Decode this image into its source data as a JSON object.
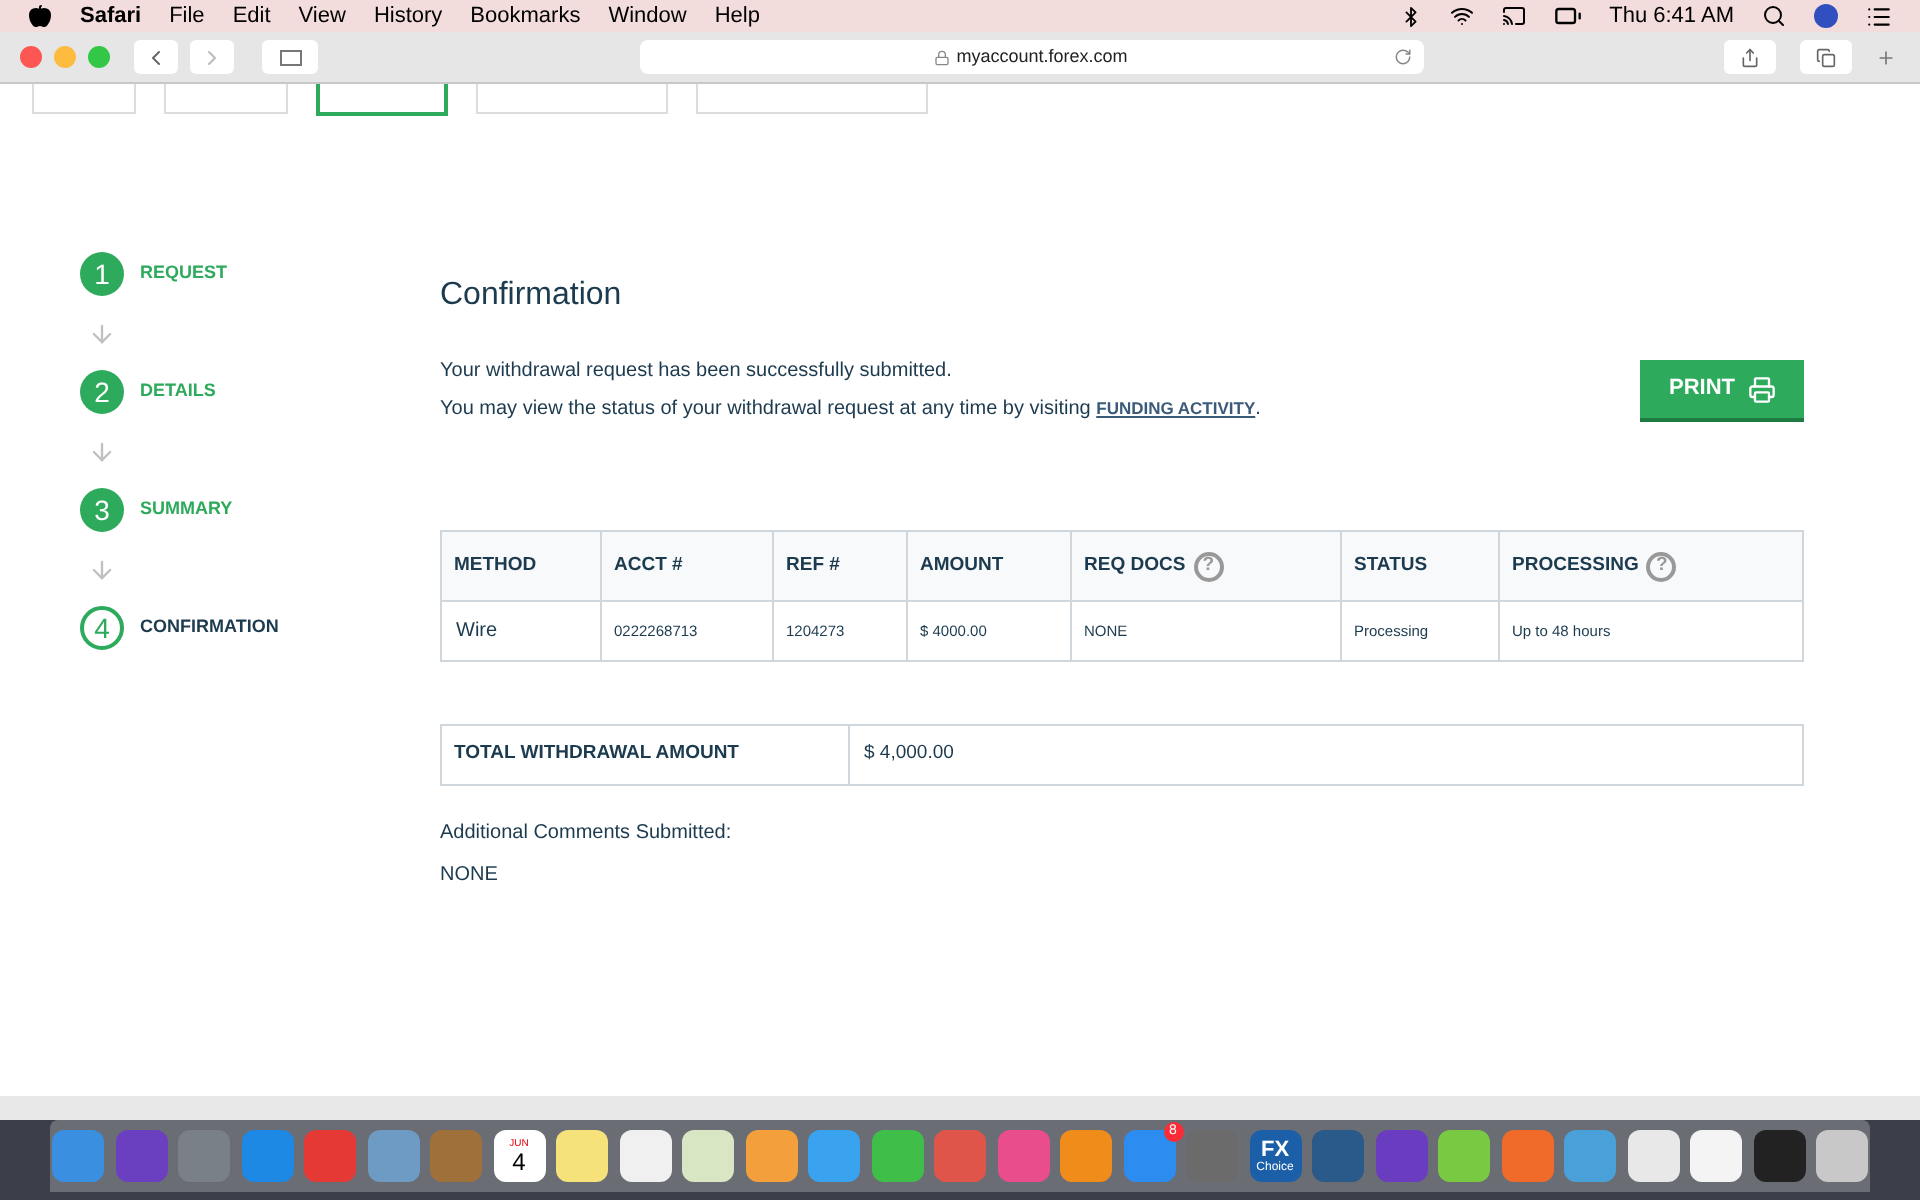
{
  "menu_bar": {
    "app": "Safari",
    "menus": [
      "File",
      "Edit",
      "View",
      "History",
      "Bookmarks",
      "Window",
      "Help"
    ],
    "clock": "Thu 6:41 AM"
  },
  "toolbar": {
    "address": "myaccount.forex.com"
  },
  "page_tabs": [
    {
      "selected": false
    },
    {
      "selected": false
    },
    {
      "selected": true
    },
    {
      "selected": false
    },
    {
      "selected": false
    }
  ],
  "steps": [
    {
      "number": "1",
      "label": "REQUEST",
      "completed": true
    },
    {
      "number": "2",
      "label": "DETAILS",
      "completed": true
    },
    {
      "number": "3",
      "label": "SUMMARY",
      "completed": true
    },
    {
      "number": "4",
      "label": "CONFIRMATION",
      "completed": false
    }
  ],
  "heading": "Confirmation",
  "message": [
    "Your withdrawal request has been successfully submitted.",
    "You may view the status of your withdrawal request at any time by visiting "
  ],
  "link": "FUNDING ACTIVITY",
  "link_after": ".",
  "print_button": "PRINT",
  "table": {
    "columns": [
      {
        "label": "METHOD"
      },
      {
        "label": "ACCT #"
      },
      {
        "label": "REF #"
      },
      {
        "label": "AMOUNT"
      },
      {
        "label": "REQ DOCS",
        "help": "?"
      },
      {
        "label": "STATUS"
      },
      {
        "label": "PROCESSING",
        "help": "?"
      }
    ],
    "rows": [
      [
        "Wire",
        "0222268713",
        "1204273",
        "$ 4000.00",
        "NONE",
        "Processing",
        "Up to 48 hours"
      ]
    ]
  },
  "total": {
    "label": "TOTAL WITHDRAWAL AMOUNT",
    "value": "$ 4,000.00"
  },
  "comments": {
    "label": "Additional Comments Submitted:",
    "value": "NONE"
  },
  "dock": [
    {
      "kind": "app",
      "color": "#3b8fe0"
    },
    {
      "kind": "app",
      "color": "#6a3fc0"
    },
    {
      "kind": "app",
      "color": "#7a8088"
    },
    {
      "kind": "app",
      "color": "#1e88e5"
    },
    {
      "kind": "app",
      "color": "#e53935"
    },
    {
      "kind": "app",
      "color": "#6d9bc3"
    },
    {
      "kind": "app",
      "color": "#a0703a"
    },
    {
      "kind": "calendar",
      "month": "JUN",
      "day": "4"
    },
    {
      "kind": "app",
      "color": "#f5e27a"
    },
    {
      "kind": "app",
      "color": "#f0f0f0"
    },
    {
      "kind": "app",
      "color": "#d9e6c4"
    },
    {
      "kind": "app",
      "color": "#f3a03c"
    },
    {
      "kind": "app",
      "color": "#3aa3f0"
    },
    {
      "kind": "app",
      "color": "#3fbf4a"
    },
    {
      "kind": "app",
      "color": "#e0554a"
    },
    {
      "kind": "app",
      "color": "#ea4d8c"
    },
    {
      "kind": "app",
      "color": "#f08c1a"
    },
    {
      "kind": "badge",
      "color": "#2d8cf0",
      "badge": "8"
    },
    {
      "kind": "app",
      "color": "#6b6b6b"
    },
    {
      "kind": "label",
      "color": "#1b5fa8",
      "text": "FX",
      "sub": "Choice"
    },
    {
      "kind": "app",
      "color": "#2a5a8a"
    },
    {
      "kind": "app",
      "color": "#6a3cc0"
    },
    {
      "kind": "app",
      "color": "#7ac943"
    },
    {
      "kind": "app",
      "color": "#f06a2a"
    },
    {
      "kind": "app",
      "color": "#4aa0d8"
    },
    {
      "kind": "app",
      "color": "#e8e8e8"
    },
    {
      "kind": "app",
      "color": "#f4f4f4"
    },
    {
      "kind": "app",
      "color": "#222222"
    },
    {
      "kind": "app",
      "color": "#c8c8c8"
    }
  ]
}
